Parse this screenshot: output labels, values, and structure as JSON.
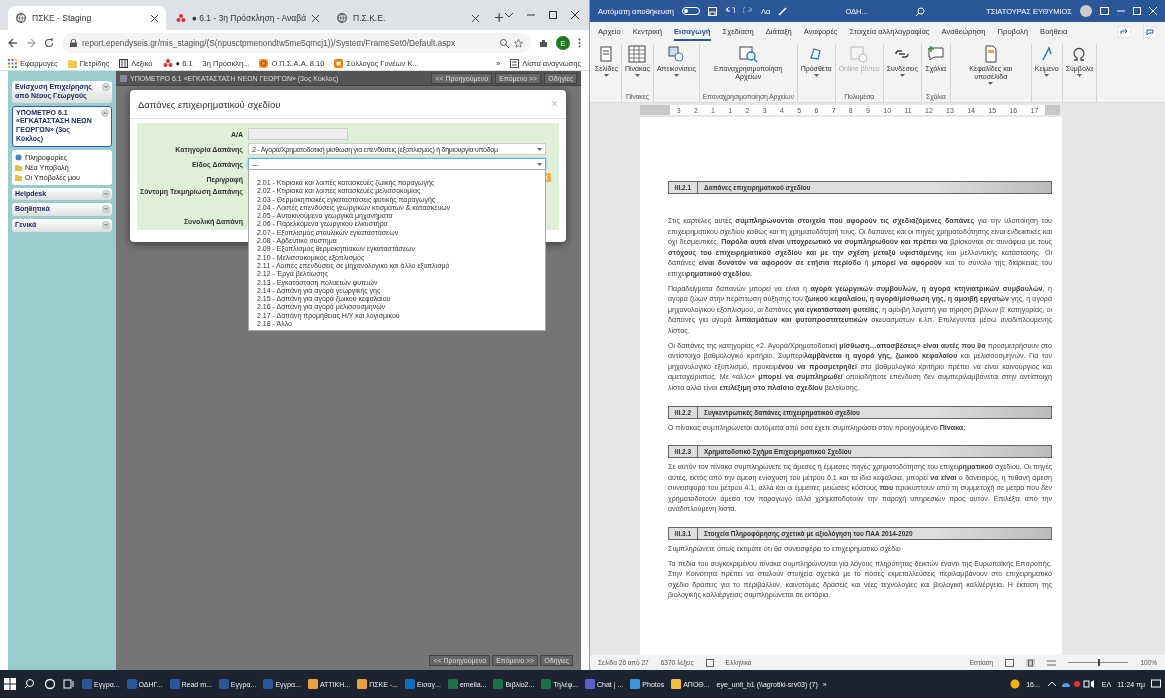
{
  "browser": {
    "tabs": [
      {
        "title": "ΠΣΚΕ - Staging",
        "kind": "globe",
        "selected": true
      },
      {
        "title": "● 6.1 - 3η Πρόσκληση - Αναβά",
        "kind": "dots",
        "selected": false
      },
      {
        "title": "Π.Σ.Κ.Ε.",
        "kind": "globe",
        "selected": false
      }
    ],
    "address": "report.ependyseis.gr/mis_staging/(S(npusctpmenondtw5me5qmcj1))/System/FrameSet0/Default.aspx",
    "profile_initial": "E",
    "bookmarks": [
      {
        "label": "Εφαρμογές",
        "kind": "apps"
      },
      {
        "label": "Πετρίδης",
        "kind": "folder"
      },
      {
        "label": "Λεξικό",
        "kind": "book"
      },
      {
        "label": "● 6.1",
        "kind": "dots"
      },
      {
        "label": "3η Πρόσκλη...",
        "kind": "none"
      },
      {
        "label": "Ο.Π.Σ.Α.Α. 8.10",
        "kind": "ring"
      },
      {
        "label": "Σύλλογος Γονέων Κ...",
        "kind": "blog"
      }
    ],
    "more": "»",
    "reading_list": "Λίστα ανάγνωσης"
  },
  "app": {
    "sidebar": [
      {
        "label": "Ενίσχυση Επιχείρησης από Νέους Γεωργούς",
        "selected": false,
        "expanded": false
      },
      {
        "label": "ΥΠΟΜΕΤΡΟ 6.1 «ΕΓΚΑΤΑΣΤΑΣΗ ΝΕΩΝ ΓΕΩΡΓΩΝ» (3ος Κύκλος)",
        "selected": true,
        "expanded": true,
        "children": [
          {
            "label": "Πληροφορίες",
            "kind": "info"
          },
          {
            "label": "Νέα Υποβολή",
            "kind": "folder"
          },
          {
            "label": "Οι Υποβολές μου",
            "kind": "folder"
          }
        ]
      },
      {
        "label": "Helpdesk",
        "selected": false,
        "expanded": false
      },
      {
        "label": "Βοηθητικά",
        "selected": false,
        "expanded": false
      },
      {
        "label": "Γενικά",
        "selected": false,
        "expanded": false
      }
    ],
    "header": "ΥΠΟΜΕΤΡΟ 6.1 «ΕΓΚΑΤΑΣΤΑΣΗ ΝΕΩΝ ΓΕΩΡΓΩΝ» (3ος Κύκλος)",
    "nav_buttons": [
      "<< Προηγούμενο",
      "Επόμενο >>",
      "Οδηγίες"
    ],
    "bottom_nav_buttons": [
      "<< Προηγούμενο",
      "Επόμενο >>",
      "Οδηγίες"
    ]
  },
  "modal": {
    "title": "Δαπάνες επιχειρηματικού σχεδίου",
    "close": "×",
    "fields": [
      {
        "label": "Α/Α",
        "kind": "readonly"
      },
      {
        "label": "Κατηγορία Δαπάνης",
        "kind": "select",
        "value": "2 - Αγορά/Χρηματοδοτική μίσθωση για επενδύσεις (εξοπλισμός) ή δημιουργία υποδομ",
        "open": false
      },
      {
        "label": "Είδος Δαπάνης",
        "kind": "select",
        "value": "---",
        "open": true
      },
      {
        "label": "Περιγραφή",
        "kind": "input"
      },
      {
        "label": "Σύντομη Τεκμηρίωση Δαπάνης",
        "kind": "textarea"
      },
      {
        "label": "Συνολική Δαπάνη",
        "kind": "input"
      }
    ],
    "options": [
      "2.01 - Κτιριακά και λοιπές κατασκευές ζωικής παραγωγής",
      "2.02 - Κτιριακά και λοιπές κατασκευές μελισσοκομίας",
      "2.03 - Θερμοκηπιακές εγκαταστάσεις φυτικής παραγωγής",
      "2.04 - Λοιπές επενδύσεις γεωργικών κτισμάτων & κατασκευών",
      "2.05 - Αυτοκινούμενα γεωργικά μηχανήματα",
      "2.06 - Παρελκόμενα γεωργικού ελκυστήρα",
      "2.07 - Εξοπλισμός σταυλικών εγκαταστάσεων",
      "2.08 - Αρδευτικό σύστημα",
      "2.09 - Εξοπλισμός θερμοκηπιακών εγκαταστάσεων",
      "2.10 - Μελισσοκομικός εξοπλισμός",
      "2.11 - Λοιπές επενδύσεις σε μηχανολογικό και άλλο εξοπλισμό",
      "2.12 - Έργα βελτίωσης",
      "2.13 - Εγκατάσταση πολυετών φυτειών",
      "2.14 - Δαπάνη για αγορά γεωργικής γης",
      "2.15 - Δαπάνη για αγορά ζωικού κεφαλαίου",
      "2.16 - Δαπάνη για αγορά μελισσοσμηνών",
      "2.17 - Δαπάνη προμήθειας Η/Υ και λογισμικού",
      "2.18 - Άλλο"
    ]
  },
  "word": {
    "autosave": {
      "label": "Αυτόματη αποθήκευση",
      "on": false
    },
    "font_button": "Λα",
    "doc_name": "ΟΔΗ...",
    "user": "ΤΣΙΑΤΟΥΡΑΣ ΕΥΘΥΜΙΟΣ",
    "tabs": [
      {
        "label": "Αρχείο",
        "selected": false
      },
      {
        "label": "Κεντρική",
        "selected": false
      },
      {
        "label": "Εισαγωγή",
        "selected": true
      },
      {
        "label": "Σχεδίαση",
        "selected": false
      },
      {
        "label": "Διάταξη",
        "selected": false
      },
      {
        "label": "Αναφορές",
        "selected": false
      },
      {
        "label": "Στοιχεία αλληλογραφίας",
        "selected": false
      },
      {
        "label": "Αναθεώρηση",
        "selected": false
      },
      {
        "label": "Προβολή",
        "selected": false
      },
      {
        "label": "Βοήθεια",
        "selected": false
      }
    ],
    "ribbon": [
      {
        "items": [
          {
            "label": "Σελίδες",
            "kind": "page",
            "dropdown": true,
            "disabled": false
          }
        ]
      },
      {
        "group": "Πίνακες",
        "items": [
          {
            "label": "Πίνακας",
            "kind": "table",
            "dropdown": true,
            "disabled": false
          }
        ]
      },
      {
        "items": [
          {
            "label": "Απεικονίσεις",
            "kind": "shapes",
            "dropdown": true,
            "disabled": false
          }
        ]
      },
      {
        "group": "Επαναχρησιμοποίηση Αρχείων",
        "items": [
          {
            "label": "Επαναχρησιμοποίηση Αρχείων",
            "kind": "reuse",
            "dropdown": false,
            "disabled": false
          }
        ]
      },
      {
        "items": [
          {
            "label": "Πρόσθετα",
            "kind": "addin",
            "dropdown": true,
            "disabled": false
          }
        ]
      },
      {
        "group": "Πολυμέσα",
        "items": [
          {
            "label": "Online βίντεο",
            "kind": "video",
            "dropdown": false,
            "disabled": true
          }
        ]
      },
      {
        "items": [
          {
            "label": "Συνδέσεις",
            "kind": "link",
            "dropdown": true,
            "disabled": false
          }
        ]
      },
      {
        "group": "Σχόλια",
        "items": [
          {
            "label": "Σχόλια",
            "kind": "comment",
            "dropdown": false,
            "disabled": false
          }
        ]
      },
      {
        "items": [
          {
            "label": "Κεφαλίδες και υποσέλιδα",
            "kind": "header",
            "dropdown": true,
            "disabled": false
          }
        ]
      },
      {
        "items": [
          {
            "label": "Κείμενο",
            "kind": "text",
            "dropdown": true,
            "disabled": false
          }
        ]
      },
      {
        "items": [
          {
            "label": "Σύμβολα",
            "kind": "omega",
            "dropdown": true,
            "disabled": false
          }
        ]
      }
    ],
    "ruler": [
      "3",
      "2",
      "1",
      "1",
      "2",
      "3",
      "4",
      "5",
      "6",
      "7",
      "8",
      "9",
      "10",
      "11",
      "12",
      "13",
      "14",
      "15",
      "16",
      "17"
    ]
  },
  "document": {
    "sections": [
      {
        "number": "III.2.1",
        "title": "Δαπάνες επιχειρηματικού σχεδίου",
        "paragraphs": [
          "Στις καρτέλες αυτές **συμπληρώνονται στοιχεία που αφορούν τις σχεδιαζόμενες δαπάνες** για την υλοποίηση του επιχειρηματικού σχεδίου καθώς και τη χρηματοδότησή τους. Οι δαπάνες και οι πηγές χρηματοδότησης είναι ενδεικτικές και όχι δεσμευτικές. **Παρόλα αυτά είναι υποχρεωτικό να συμπληρωθούν και πρέπει να** βρίσκονται σε συνάφεια με τους **στόχους του επιχειρηματικού σχεδίου και με την σχέση μεταξύ υφιστάμενης** και μελλοντικής κατάστασης. Οι δαπάνες **είναι δυνατόν να αφορούν σε ετήσια περίοδο** ή **μπορεί να αφορούν** και το σύνολο της διάρκειας του επιχει**ρηματικού σχεδίου.**",
          "Παραδείγματα δαπανών μπορεί να είναι η **αγορά γεωργικών συμβουλών, η αγορά κτηνιατρικών συμβουλών**, η αγορά ζώων στην περίπτωση αύξησης του **ζωικού κεφαλαίου, η αγορά/μίσθωση γης, η αμοιβή εργατών** γης, η αγορά μηχανολογικού εξοπλισμού, οι δαπάνες **για εγκατάσταση φυτείας**, η αμοιβή λογιστή για τήρηση βιβλίων β' κατηγορίας, οι δαπάνες για αγορά **λιπασμάτων και φυτοπροστατευτικών** σκευασμάτων κ.λπ. Επιλέγονται μέσω αναδιπλούμενης λίστας.",
          "Οι δαπάνες της κατηγορίας «2. Αγορά/Χρηματοδοτική **μίσθωση…αποσβέσεις» είναι αυτές που θα** προσμετρήσουν στο αντίστοιχο βαθμολογικό κριτήριο. Συμπερι**λαμβάνεται η αγορά γης, ζωικού κεφαλαίου** και μελισσοσμηνών. Για τον μηχανολογικό εξοπλισμό, προκειμ**ένου να προσμετρηθεί** στο βαθμολογικό κριτήριο πρέπει να είναι καινούργιος και αμεταχείριστος. Με «άλλο» **μπορεί να συμπληρωθεί** οποιαδήποτε επένδυση δεν συμπεριλαμβάνεται στην αντίστοιχη λίστα αλλά είναι **επιλέξιμη στο πλαίσιο σχεδίου** βελτίωσης."
        ]
      },
      {
        "number": "III.2.2",
        "title": "Συγκεντρωτικές δαπάνες επιχειρηματικού σχεδίου",
        "paragraphs": [
          "Ο πίνακας συμπληρώνεται αυτόματα από όσα έχετε συμπληρώσει στον προηγούμενο **Πίνακα.**"
        ]
      },
      {
        "number": "III.2.3",
        "title": "Χρηματοδοτικό Σχήμα Επιχειρηματικού Σχεδίου",
        "paragraphs": [
          "Σε αυτόν τον πίνακα συμπληρώνετε τις άμεσες ή έμμεσες πηγές χρηματοδότησης του επιχει**ρηματικού** σχεδίου. Οι πηγές αυτές, εκτός από την άμεση ενίσχυση του μέτρου 6.1 και τα ίδια κεφάλαια, μπορεί **να είναι** ο δανεισμός, η πιθανή άμεση συνεισφορά του μέτρου 4.1, αλλά και οι έμμεσες μειώσεις κόστους **που** προκύπτουν από τη συμμετοχή σε μέτρα που δεν χρηματοδοτούν άμεσα τον παραγωγό αλλά χρηματοδοτούν την παροχή υπηρεσιών προς αυτόν. Επιλέξτε από την αναδιπλούμενη λίστα."
        ]
      },
      {
        "number": "III.3.1",
        "title": "Στοιχεία Πληροφόρησης σχετικά με αξιολόγηση του ΠΑΑ 2014-2020",
        "paragraphs": [
          "Συμπληρώνετε όπως εκτιμάτε ότι θα συνεισφέρει το επιχειρηματικό σχέδιο",
          "Τα πεδία του συγκεκριμένου πίνακα συμπληρώνονται για λόγους πληρότητας δεικτών έναντι της Ευρωπαϊκής Επιτροπής. Στην Κοινότητα πρέπει να σταλούν στοιχεία σχετικά με το πόσες εκμεταλλεύσεις περιλαμβάνουν στο επιχειρηματικό σχέδιο δράσεις για το περιβάλλον, καινοτόμες δράσεις και νέες τεχνολογίες και βιολογική καλλιέργεια. Η έκταση της βιολογικής καλλιέργειας συμπληρώνεται σε εκτάρια."
        ]
      }
    ]
  },
  "status_bar": {
    "page": "Σελίδα 26 από 27",
    "words": "6370 λέξεις",
    "language": "Ελληνικά",
    "focus": "Εστίαση",
    "zoom": {
      "label": "100%",
      "level": 0.5
    }
  },
  "taskbar": {
    "items": [
      {
        "label": "Εγγρα...",
        "kind": "word"
      },
      {
        "label": "ΟΔΗΓ...",
        "kind": "word"
      },
      {
        "label": "Read m...",
        "kind": "word"
      },
      {
        "label": "Εγγρα...",
        "kind": "word"
      },
      {
        "label": "Εγγρα...",
        "kind": "word"
      },
      {
        "label": "ΑΤΤΙΚΗ...",
        "kind": "chrome"
      },
      {
        "label": "ΠΣΚΕ -...",
        "kind": "chrome"
      },
      {
        "label": "Εισαγ...",
        "kind": "outlook"
      },
      {
        "label": "emelia...",
        "kind": "excel"
      },
      {
        "label": "Βιβλίο2...",
        "kind": "excel"
      },
      {
        "label": "Τηλέφ...",
        "kind": "excel"
      },
      {
        "label": "Chat | ...",
        "kind": "teams"
      },
      {
        "label": "Photos",
        "kind": "photos"
      },
      {
        "label": "ΑΠΟΘ...",
        "kind": "folder"
      },
      {
        "label": "eye_unit_b1 (\\\\agrotiki-srv03) (7)",
        "kind": "none"
      }
    ],
    "more": "»",
    "weather": "16...",
    "language": "ΕΛ",
    "time": "11:24 πμ"
  }
}
